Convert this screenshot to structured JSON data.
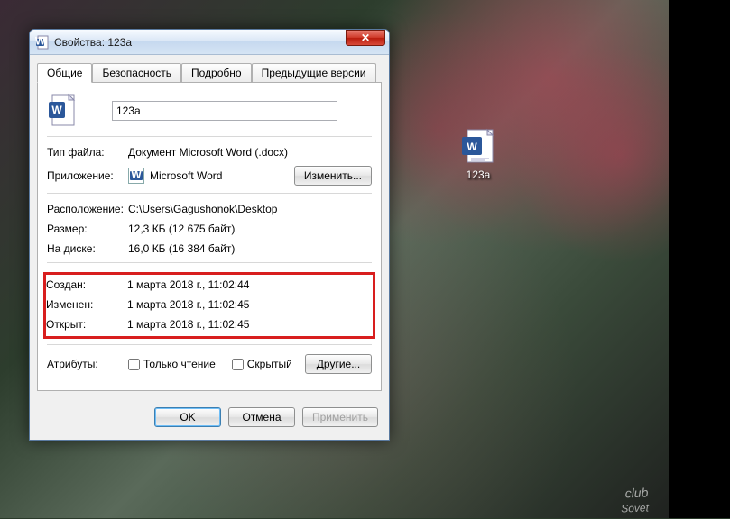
{
  "window": {
    "title": "Свойства: 123a",
    "close": "✕"
  },
  "tabs": {
    "general": "Общие",
    "security": "Безопасность",
    "details": "Подробно",
    "previous": "Предыдущие версии"
  },
  "fields": {
    "filename": "123a",
    "filetype_label": "Тип файла:",
    "filetype_value": "Документ Microsoft Word (.docx)",
    "application_label": "Приложение:",
    "application_value": "Microsoft Word",
    "change_btn": "Изменить...",
    "location_label": "Расположение:",
    "location_value": "C:\\Users\\Gagushonok\\Desktop",
    "size_label": "Размер:",
    "size_value": "12,3 КБ (12 675 байт)",
    "size_on_disk_label": "На диске:",
    "size_on_disk_value": "16,0 КБ (16 384 байт)",
    "created_label": "Создан:",
    "created_value": "1 марта 2018 г., 11:02:44",
    "modified_label": "Изменен:",
    "modified_value": "1 марта 2018 г., 11:02:45",
    "accessed_label": "Открыт:",
    "accessed_value": "1 марта 2018 г., 11:02:45"
  },
  "attributes": {
    "label": "Атрибуты:",
    "readonly": "Только чтение",
    "hidden": "Скрытый",
    "other_btn": "Другие..."
  },
  "buttons": {
    "ok": "OK",
    "cancel": "Отмена",
    "apply": "Применить"
  },
  "desktop": {
    "icon_label": "123a"
  },
  "watermark": {
    "top": "club",
    "main": "Sovet"
  }
}
